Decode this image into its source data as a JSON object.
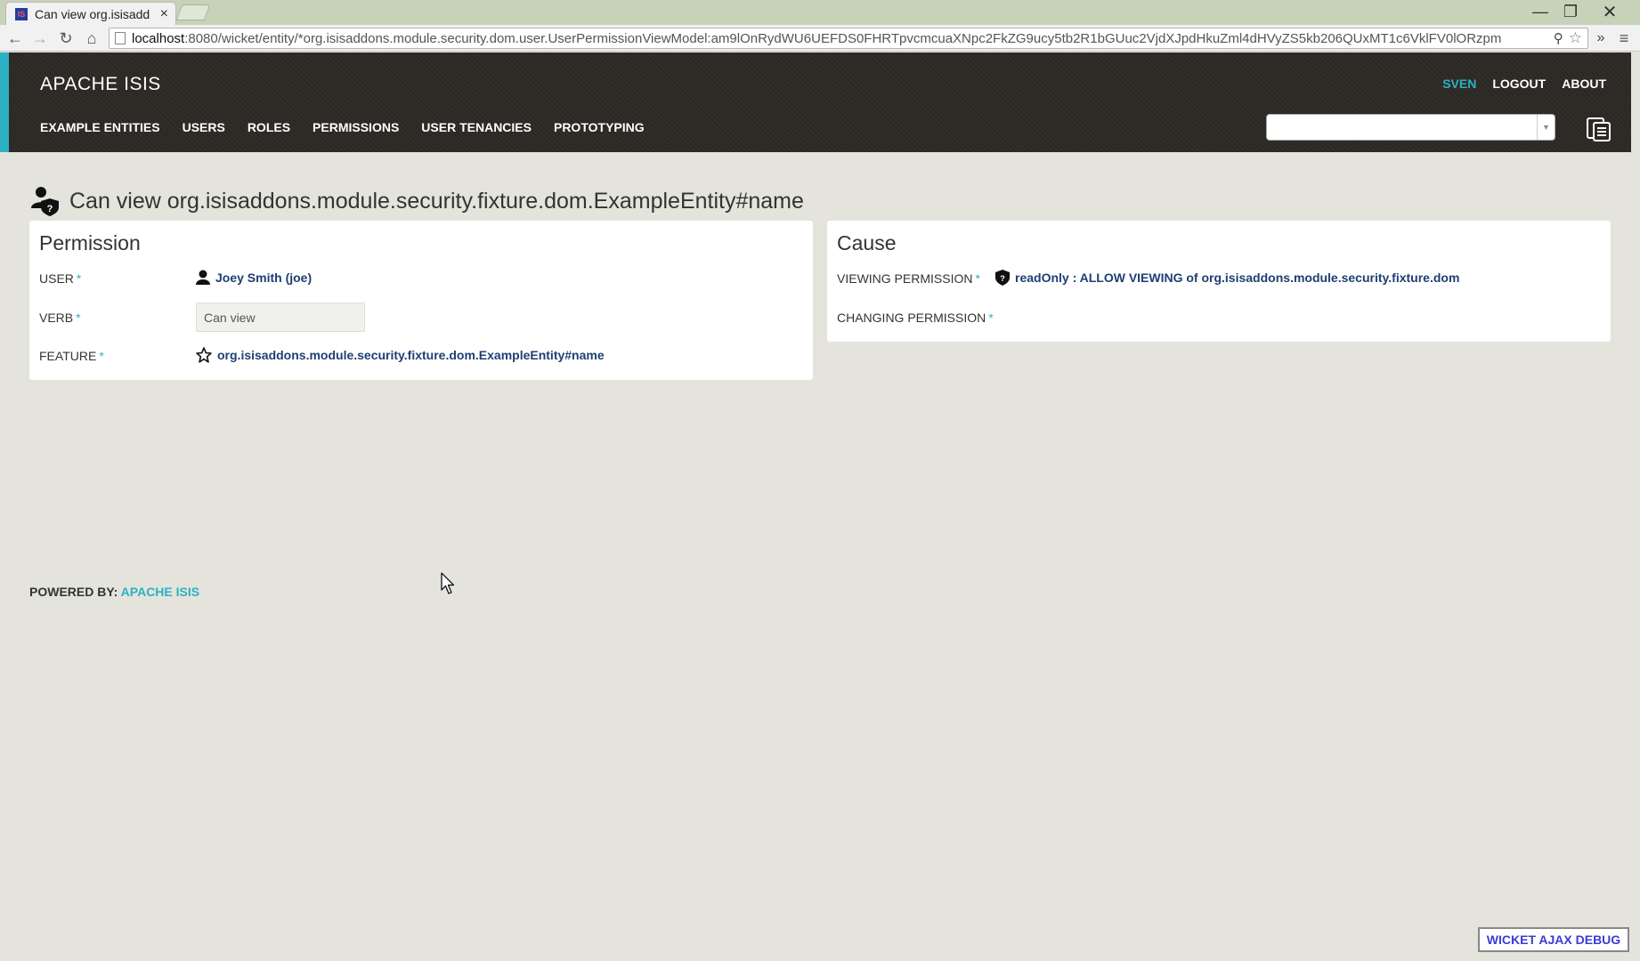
{
  "browser": {
    "tab_title": "Can view org.isisadd",
    "tab_favicon_text": "IS",
    "url_host": "localhost",
    "url_rest": ":8080/wicket/entity/*org.isisaddons.module.security.dom.user.UserPermissionViewModel:am9lOnRydWU6UEFDS0FHRTpvcmcuaXNpc2FkZG9ucy5tb2R1bGUuc2VjdXJpdHkuZml4dHVyZS5kb206QUxMT1c6VklFV0lORzpm"
  },
  "header": {
    "brand": "APACHE ISIS",
    "nav": [
      "EXAMPLE ENTITIES",
      "USERS",
      "ROLES",
      "PERMISSIONS",
      "USER TENANCIES",
      "PROTOTYPING"
    ],
    "user": "SVEN",
    "logout": "LOGOUT",
    "about": "ABOUT",
    "search_value": ""
  },
  "page": {
    "title": "Can view org.isisaddons.module.security.fixture.dom.ExampleEntity#name"
  },
  "permission_panel": {
    "heading": "Permission",
    "user_label": "USER",
    "user_value": "Joey Smith (joe)",
    "verb_label": "VERB",
    "verb_value": "Can view",
    "feature_label": "FEATURE",
    "feature_value": "org.isisaddons.module.security.fixture.dom.ExampleEntity#name",
    "required_mark": "*"
  },
  "cause_panel": {
    "heading": "Cause",
    "viewing_label": "VIEWING PERMISSION",
    "viewing_value": "readOnly : ALLOW VIEWING of org.isisaddons.module.security.fixture.dom",
    "changing_label": "CHANGING PERMISSION",
    "changing_value": "",
    "required_mark": "*"
  },
  "footer": {
    "powered_by": "POWERED BY: ",
    "link": "APACHE ISIS"
  },
  "debug_button": "WICKET AJAX DEBUG",
  "icons": {
    "title": "user-permission-icon",
    "user": "person-icon",
    "feature": "star-icon",
    "viewing": "shield-icon",
    "clipboard": "clipboard-icon"
  },
  "colors": {
    "accent": "#2bb1c3",
    "link": "#1e3f73",
    "header_bg": "#2c2925",
    "page_bg": "#e4e4dd",
    "debug_link": "#3b3bd6"
  }
}
